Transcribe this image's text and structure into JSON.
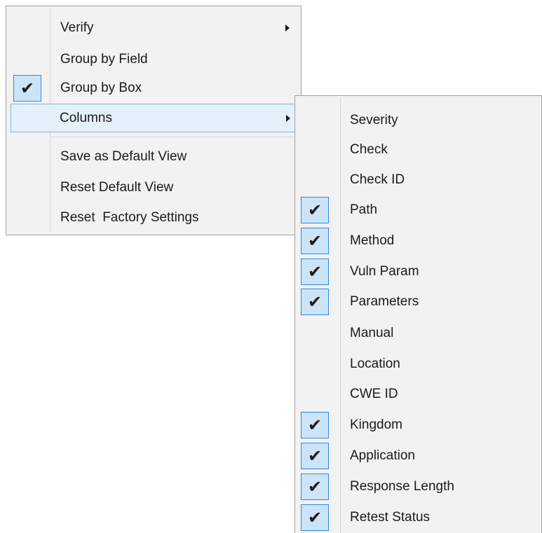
{
  "main_menu": {
    "items": [
      {
        "label": "Verify",
        "checked": false,
        "submenu": true
      },
      {
        "label": "Group by Field",
        "checked": false,
        "submenu": false
      },
      {
        "label": "Group by Box",
        "checked": true,
        "submenu": false
      },
      {
        "label": "Columns",
        "checked": false,
        "submenu": true,
        "highlighted": true
      },
      {
        "label": "Save as Default View",
        "checked": false,
        "submenu": false
      },
      {
        "label": "Reset Default View",
        "checked": false,
        "submenu": false
      },
      {
        "label": "Reset  Factory Settings",
        "checked": false,
        "submenu": false
      }
    ]
  },
  "columns_submenu": {
    "items": [
      {
        "label": "Severity",
        "checked": false
      },
      {
        "label": "Check",
        "checked": false
      },
      {
        "label": "Check ID",
        "checked": false
      },
      {
        "label": "Path",
        "checked": true
      },
      {
        "label": "Method",
        "checked": true
      },
      {
        "label": "Vuln Param",
        "checked": true
      },
      {
        "label": "Parameters",
        "checked": true
      },
      {
        "label": "Manual",
        "checked": false
      },
      {
        "label": "Location",
        "checked": false
      },
      {
        "label": "CWE ID",
        "checked": false
      },
      {
        "label": "Kingdom",
        "checked": true
      },
      {
        "label": "Application",
        "checked": true
      },
      {
        "label": "Response Length",
        "checked": true
      },
      {
        "label": "Retest Status",
        "checked": true
      }
    ]
  },
  "icons": {
    "check": "✔",
    "submenu_arrow": "chevron-right-icon"
  },
  "colors": {
    "menu_bg": "#f2f2f2",
    "check_bg": "#cce4f7",
    "check_border": "#2d8ae0",
    "highlight_bg": "#e3f1fa",
    "highlight_border": "#7eb4ea"
  }
}
